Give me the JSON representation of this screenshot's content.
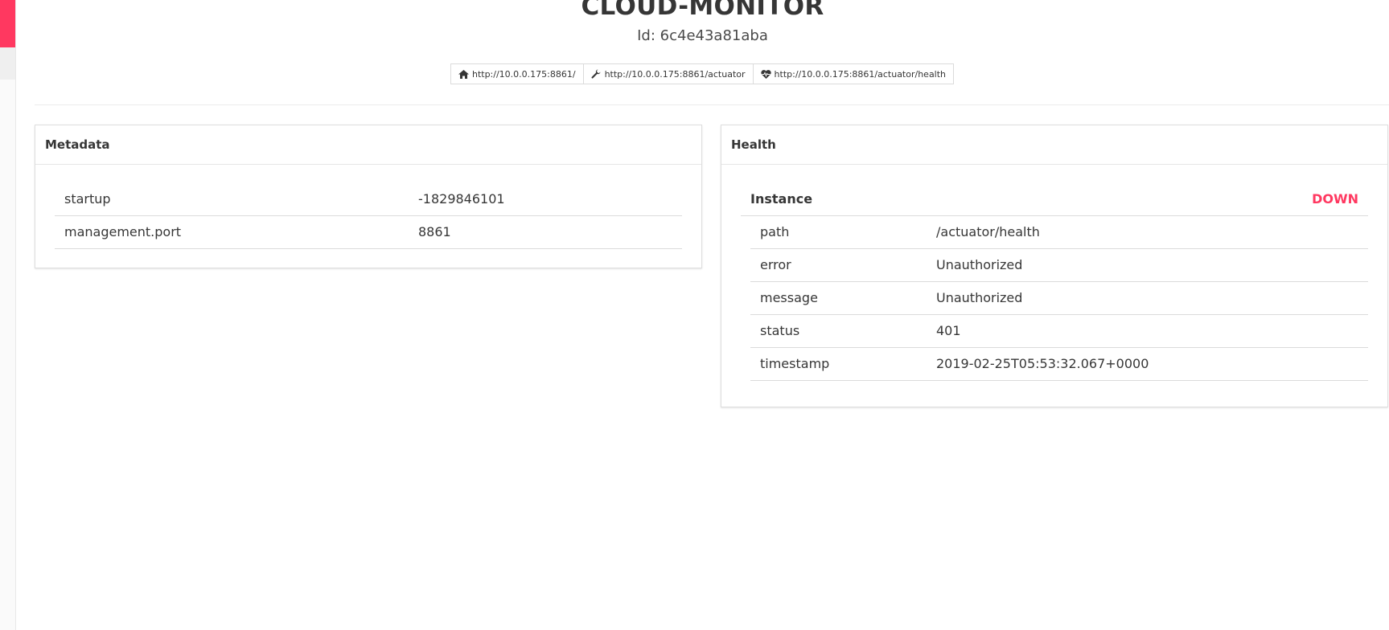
{
  "app": {
    "title": "CLOUD-MONITOR",
    "id_text": "Id: 6c4e43a81aba"
  },
  "links": [
    {
      "label": "http://10.0.0.175:8861/",
      "icon": "home-icon"
    },
    {
      "label": "http://10.0.0.175:8861/actuator",
      "icon": "wrench-icon"
    },
    {
      "label": "http://10.0.0.175:8861/actuator/health",
      "icon": "heartbeat-icon"
    }
  ],
  "metadata": {
    "title": "Metadata",
    "rows": [
      {
        "key": "startup",
        "value": "-1829846101"
      },
      {
        "key": "management.port",
        "value": "8861"
      }
    ]
  },
  "health": {
    "title": "Health",
    "instance_label": "Instance",
    "instance_status": "DOWN",
    "rows": [
      {
        "key": "path",
        "value": "/actuator/health"
      },
      {
        "key": "error",
        "value": "Unauthorized"
      },
      {
        "key": "message",
        "value": "Unauthorized"
      },
      {
        "key": "status",
        "value": "401"
      },
      {
        "key": "timestamp",
        "value": "2019-02-25T05:53:32.067+0000"
      }
    ]
  },
  "colors": {
    "accent": "#ff3860",
    "text": "#363636",
    "border": "#dbdbdb"
  }
}
